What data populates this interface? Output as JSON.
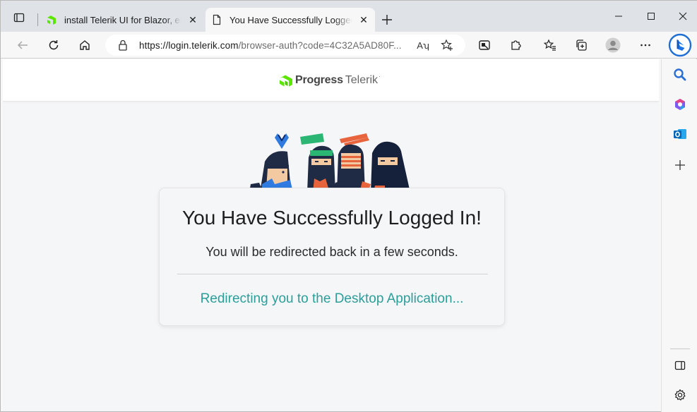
{
  "browser": {
    "tabs": [
      {
        "title": "install Telerik UI for Blazor, error c",
        "active": false,
        "favicon": "telerik-favicon"
      },
      {
        "title": "You Have Successfully Logged In",
        "active": true,
        "favicon": "page-icon"
      }
    ],
    "address_bar": {
      "url_host": "https://login.telerik.com",
      "url_path": "/browser-auth?code=4C32A5AD80F...",
      "read_aloud_label": "Aʮ"
    },
    "window_controls": [
      "minimize",
      "maximize",
      "close"
    ]
  },
  "site": {
    "logo_primary": "Progress",
    "logo_secondary": "Telerik",
    "logo_trademark": "·"
  },
  "card": {
    "heading": "You Have Successfully Logged In!",
    "subtext": "You will be redirected back in a few seconds.",
    "redirect_text": "Redirecting you to the Desktop Application..."
  },
  "colors": {
    "accent_teal": "#2b9e9a",
    "progress_green": "#5ce500",
    "edge_blue": "#0078d4"
  }
}
